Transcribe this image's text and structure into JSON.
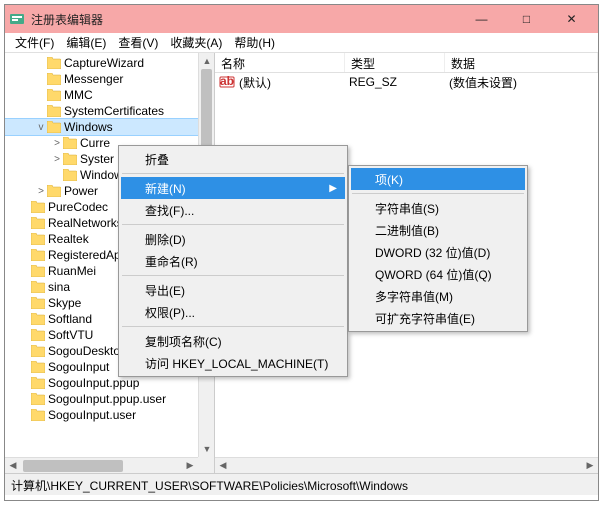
{
  "title": "注册表编辑器",
  "titlebar": {
    "min": "—",
    "max": "□",
    "close": "✕"
  },
  "menu": {
    "file": "文件(F)",
    "edit": "编辑(E)",
    "view": "查看(V)",
    "favorites": "收藏夹(A)",
    "help": "帮助(H)"
  },
  "tree": [
    {
      "indent": 30,
      "exp": "",
      "label": "CaptureWizard"
    },
    {
      "indent": 30,
      "exp": "",
      "label": "Messenger"
    },
    {
      "indent": 30,
      "exp": "",
      "label": "MMC"
    },
    {
      "indent": 30,
      "exp": "",
      "label": "SystemCertificates"
    },
    {
      "indent": 30,
      "exp": "v",
      "label": "Windows",
      "selected": true
    },
    {
      "indent": 46,
      "exp": ">",
      "label": "Curre"
    },
    {
      "indent": 46,
      "exp": ">",
      "label": "Syster"
    },
    {
      "indent": 46,
      "exp": "",
      "label": "Windows"
    },
    {
      "indent": 30,
      "exp": ">",
      "label": "Power"
    },
    {
      "indent": 14,
      "exp": "",
      "label": "PureCodec"
    },
    {
      "indent": 14,
      "exp": "",
      "label": "RealNetworks"
    },
    {
      "indent": 14,
      "exp": "",
      "label": "Realtek"
    },
    {
      "indent": 14,
      "exp": "",
      "label": "RegisteredAppl"
    },
    {
      "indent": 14,
      "exp": "",
      "label": "RuanMei"
    },
    {
      "indent": 14,
      "exp": "",
      "label": "sina"
    },
    {
      "indent": 14,
      "exp": "",
      "label": "Skype"
    },
    {
      "indent": 14,
      "exp": "",
      "label": "Softland"
    },
    {
      "indent": 14,
      "exp": "",
      "label": "SoftVTU"
    },
    {
      "indent": 14,
      "exp": "",
      "label": "SogouDesktopBar"
    },
    {
      "indent": 14,
      "exp": "",
      "label": "SogouInput"
    },
    {
      "indent": 14,
      "exp": "",
      "label": "SogouInput.ppup"
    },
    {
      "indent": 14,
      "exp": "",
      "label": "SogouInput.ppup.user"
    },
    {
      "indent": 14,
      "exp": "",
      "label": "SogouInput.user"
    }
  ],
  "listHeader": {
    "name": "名称",
    "type": "类型",
    "data": "数据"
  },
  "listRows": [
    {
      "name": "(默认)",
      "type": "REG_SZ",
      "data": "(数值未设置)"
    }
  ],
  "contextMenu1": {
    "collapse": "折叠",
    "new": "新建(N)",
    "find": "查找(F)...",
    "delete": "删除(D)",
    "rename": "重命名(R)",
    "export": "导出(E)",
    "permissions": "权限(P)...",
    "copyKeyName": "复制项名称(C)",
    "goto": "访问 HKEY_LOCAL_MACHINE(T)"
  },
  "contextMenu2": {
    "key": "项(K)",
    "string": "字符串值(S)",
    "binary": "二进制值(B)",
    "dword": "DWORD (32 位)值(D)",
    "qword": "QWORD (64 位)值(Q)",
    "multistring": "多字符串值(M)",
    "expandstring": "可扩充字符串值(E)"
  },
  "statusbar": "计算机\\HKEY_CURRENT_USER\\SOFTWARE\\Policies\\Microsoft\\Windows"
}
